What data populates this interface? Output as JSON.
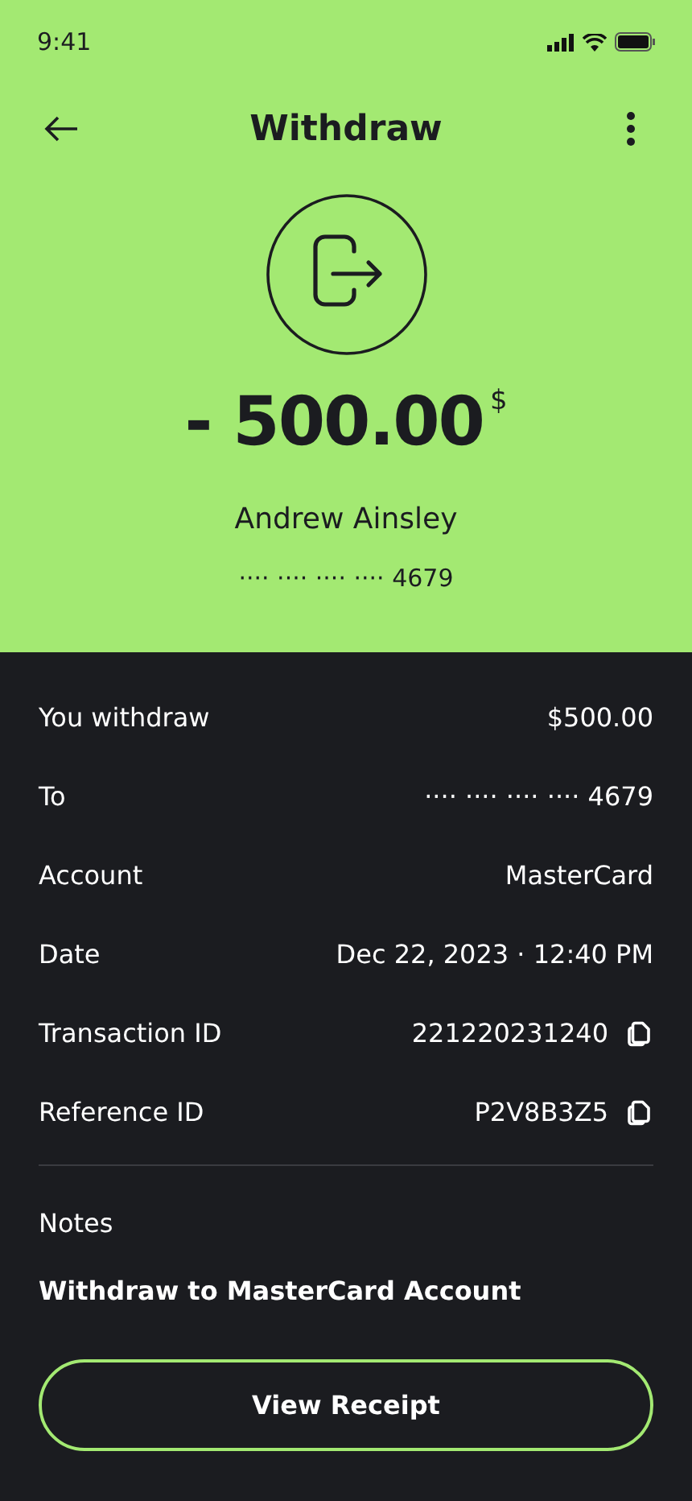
{
  "status_bar": {
    "time": "9:41"
  },
  "header": {
    "title": "Withdraw"
  },
  "summary": {
    "amount": "- 500.00",
    "currency": "$",
    "name": "Andrew Ainsley",
    "card": "···· ···· ···· ···· 4679"
  },
  "details": [
    {
      "label": "You withdraw",
      "value": "$500.00",
      "kind": "text"
    },
    {
      "label": "To",
      "value": "···· ···· ···· ···· 4679",
      "kind": "text"
    },
    {
      "label": "Account",
      "value": "MasterCard",
      "kind": "text"
    },
    {
      "label": "Date",
      "value": "Dec 22, 2023 · 12:40 PM",
      "kind": "text"
    },
    {
      "label": "Transaction ID",
      "value": "221220231240",
      "kind": "copy"
    },
    {
      "label": "Reference ID",
      "value": "P2V8B3Z5",
      "kind": "copy"
    }
  ],
  "notes": {
    "label": "Notes",
    "text": "Withdraw to MasterCard Account"
  },
  "button": {
    "label": "View Receipt"
  }
}
